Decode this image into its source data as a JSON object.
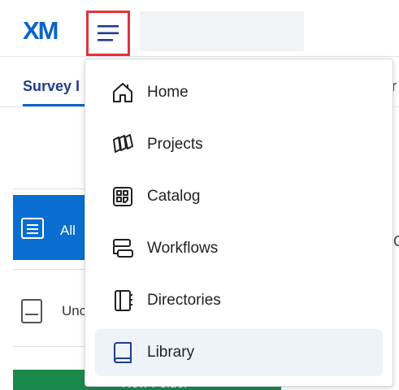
{
  "app": {
    "logo_text": "XM"
  },
  "tabs": {
    "survey_label": "Survey I",
    "right_fragment": "r"
  },
  "left_panel": {
    "all_label": "All",
    "uncategorized_label": "Unc",
    "right_fragment": "C",
    "new_folder_label": "New Folder"
  },
  "nav_menu": {
    "items": [
      {
        "label": "Home",
        "icon": "home-icon",
        "active": false
      },
      {
        "label": "Projects",
        "icon": "projects-icon",
        "active": false
      },
      {
        "label": "Catalog",
        "icon": "catalog-icon",
        "active": false
      },
      {
        "label": "Workflows",
        "icon": "workflows-icon",
        "active": false
      },
      {
        "label": "Directories",
        "icon": "directories-icon",
        "active": false
      },
      {
        "label": "Library",
        "icon": "library-icon",
        "active": true
      }
    ]
  },
  "colors": {
    "brand": "#0a64c8",
    "highlight_border": "#e0333a",
    "active_item_bg": "#eef3fa",
    "green": "#1a8a4a"
  }
}
